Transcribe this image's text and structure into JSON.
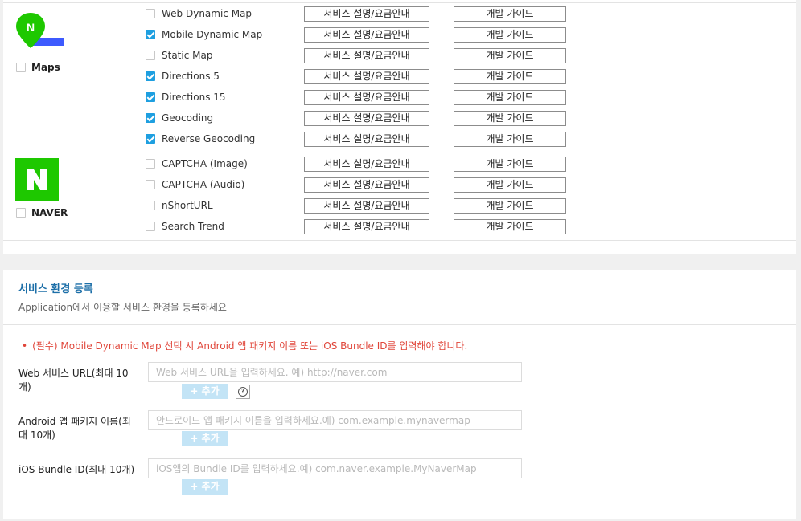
{
  "categories": [
    {
      "label": "Maps",
      "apis": [
        {
          "name": "Web Dynamic Map",
          "checked": false
        },
        {
          "name": "Mobile Dynamic Map",
          "checked": true
        },
        {
          "name": "Static Map",
          "checked": false
        },
        {
          "name": "Directions 5",
          "checked": true
        },
        {
          "name": "Directions 15",
          "checked": true
        },
        {
          "name": "Geocoding",
          "checked": true
        },
        {
          "name": "Reverse Geocoding",
          "checked": true
        }
      ]
    },
    {
      "label": "NAVER",
      "apis": [
        {
          "name": "CAPTCHA (Image)",
          "checked": false
        },
        {
          "name": "CAPTCHA (Audio)",
          "checked": false
        },
        {
          "name": "nShortURL",
          "checked": false
        },
        {
          "name": "Search Trend",
          "checked": false
        }
      ]
    }
  ],
  "buttons": {
    "service_info": "서비스 설명/요금안내",
    "dev_guide": "개발 가이드"
  },
  "env_section": {
    "title": "서비스 환경 등록",
    "subtitle": "Application에서 이용할 서비스 환경을 등록하세요",
    "notice": "(필수) Mobile Dynamic Map 선택 시 Android 앱 패키지 이름 또는 iOS Bundle ID를 입력해야 합니다.",
    "add_label": "+ 추가",
    "fields": [
      {
        "label": "Web 서비스 URL(최대 10개)",
        "placeholder": "Web 서비스 URL을 입력하세요. 예) http://naver.com",
        "value": ""
      },
      {
        "label": "Android 앱 패키지 이름(최대 10개)",
        "placeholder": "안드로이드 앱 패키지 이름을 입력하세요.예) com.example.mynavermap",
        "value": ""
      },
      {
        "label": "iOS Bundle ID(최대 10개)",
        "placeholder": "iOS앱의 Bundle ID를 입력하세요.예) com.naver.example.MyNaverMap",
        "value": ""
      }
    ]
  },
  "colors": {
    "accent": "#1e9fe0",
    "maps_logo_green": "#1ec800",
    "maps_logo_blue": "#3d5afe",
    "naver_green": "#1ec800",
    "notice_red": "#e0463a",
    "section_title_blue": "#1d6fa8"
  }
}
